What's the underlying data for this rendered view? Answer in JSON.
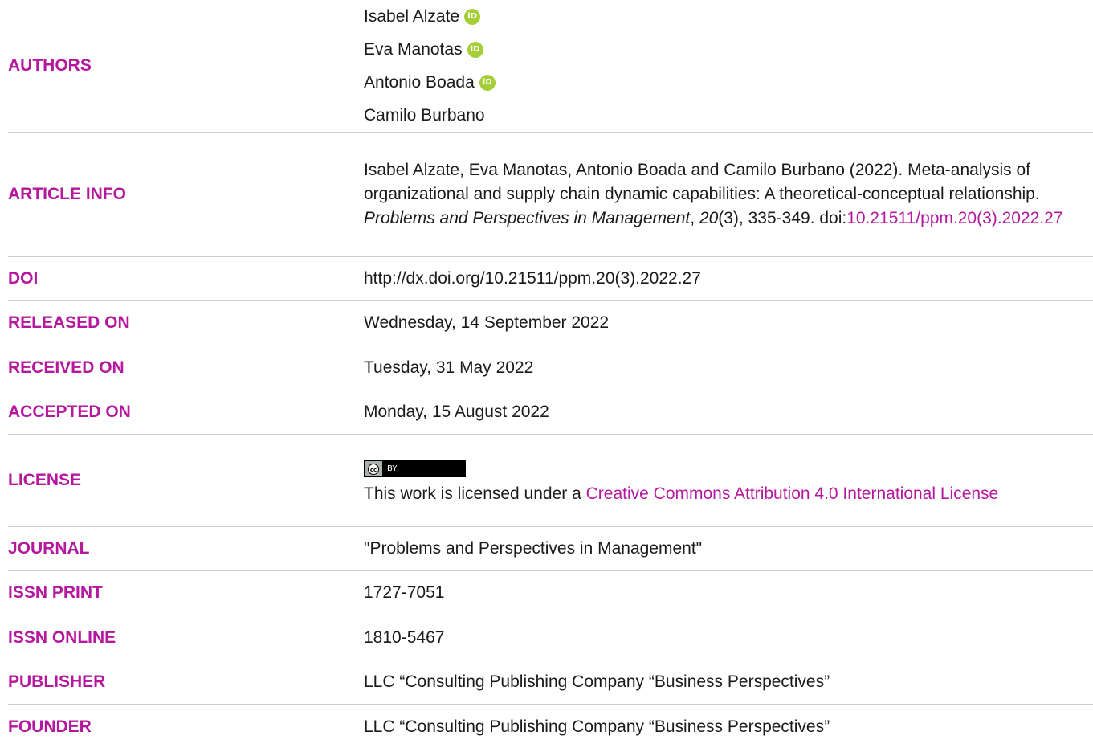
{
  "authors": {
    "label": "AUTHORS",
    "names": [
      "Isabel Alzate",
      "Eva Manotas",
      "Antonio Boada",
      "Camilo Burbano"
    ],
    "orcid_badge": "iD"
  },
  "article_info": {
    "label": "ARTICLE INFO",
    "authors_year": "Isabel Alzate, Eva Manotas, Antonio Boada and Camilo Burbano (2022).",
    "title": "Meta-analysis of organizational and supply chain dynamic capabilities: A theoretical-conceptual relationship.",
    "journal": "Problems and Perspectives in Management",
    "volume": "20",
    "issue_pages": "(3), 335-349.",
    "doi_prefix": "doi:",
    "doi_link": "10.21511/ppm.20(3).2022.27"
  },
  "doi": {
    "label": "DOI",
    "value": "http://dx.doi.org/10.21511/ppm.20(3).2022.27"
  },
  "released": {
    "label": "RELEASED ON",
    "value": "Wednesday, 14 September 2022"
  },
  "received": {
    "label": "RECEIVED ON",
    "value": "Tuesday, 31 May 2022"
  },
  "accepted": {
    "label": "ACCEPTED ON",
    "value": "Monday, 15 August 2022"
  },
  "license": {
    "label": "LICENSE",
    "badge_left": "cc",
    "badge_right": "BY",
    "text_prefix": "This work is licensed under a ",
    "link_text": "Creative Commons Attribution 4.0 International License"
  },
  "journal": {
    "label": "JOURNAL",
    "value": "\"Problems and Perspectives in Management\""
  },
  "issn_print": {
    "label": "ISSN PRINT",
    "value": "1727-7051"
  },
  "issn_online": {
    "label": "ISSN ONLINE",
    "value": "1810-5467"
  },
  "publisher": {
    "label": "PUBLISHER",
    "value": "LLC “Consulting Publishing Company “Business Perspectives”"
  },
  "founder": {
    "label": "FOUNDER",
    "value": "LLC “Consulting Publishing Company “Business Perspectives”"
  },
  "colors": {
    "accent": "#b5179e",
    "orcid": "#a6ce39",
    "text": "#1a1a1a",
    "divider": "#cfcfcf"
  }
}
